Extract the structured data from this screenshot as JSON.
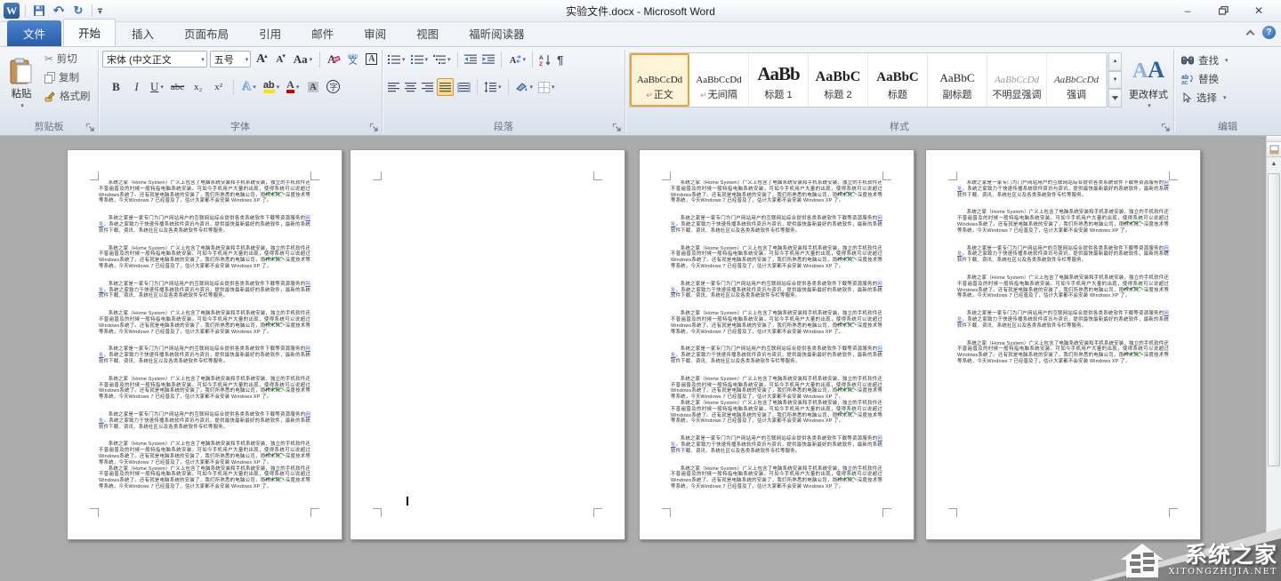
{
  "window": {
    "title": "实验文件.docx - Microsoft Word"
  },
  "icons": {
    "word_logo": "W",
    "save": "save-floppy",
    "undo": "↶",
    "redo": "↻",
    "dropdown": "▾",
    "qat_bar": "▬",
    "minimize": "–",
    "restore": "❐",
    "close": "✕",
    "help": "?",
    "collapse_ribbon": "chevron-up",
    "cut": "✂",
    "pilcrow": "¶",
    "return_mark": "↵",
    "scroll_up": "▲",
    "scroll_down": "▼",
    "grow_a": "A",
    "shrink_a": "A",
    "caret_up": "▴",
    "caret_down": "▾",
    "change_case": "Aa",
    "clear_format": "A",
    "phonetic_top": "wén",
    "phonetic_bottom": "文",
    "char_border": "A",
    "bold": "B",
    "italic": "I",
    "underline": "U",
    "strike": "abc",
    "subscript": "x₂",
    "superscript": "x²",
    "text_effect": "A",
    "highlight": "ab",
    "font_color": "A",
    "char_shade": "A",
    "enclose": "字",
    "sort": "A→Z↓",
    "aa_1": "A",
    "aa_2": "A"
  },
  "tabs": {
    "file": "文件",
    "items": [
      "开始",
      "插入",
      "页面布局",
      "引用",
      "邮件",
      "审阅",
      "视图",
      "福昕阅读器"
    ],
    "active_index": 0
  },
  "ribbon": {
    "clipboard": {
      "label": "剪贴板",
      "paste": "粘贴",
      "cut": "剪切",
      "copy": "复制",
      "format_painter": "格式刷"
    },
    "font": {
      "label": "字体",
      "name_value": "宋体 (中文正文",
      "size_value": "五号"
    },
    "paragraph": {
      "label": "段落"
    },
    "styles": {
      "label": "样式",
      "change": "更改样式",
      "items": [
        {
          "preview": "AaBbCcDd",
          "label": "正文",
          "kind": "body",
          "selected": true,
          "pilcrow": true
        },
        {
          "preview": "AaBbCcDd",
          "label": "无间隔",
          "kind": "body",
          "selected": false,
          "pilcrow": true
        },
        {
          "preview": "AaBb",
          "label": "标题 1",
          "kind": "h1",
          "selected": false,
          "pilcrow": false
        },
        {
          "preview": "AaBbC",
          "label": "标题 2",
          "kind": "h2",
          "selected": false,
          "pilcrow": false
        },
        {
          "preview": "AaBbC",
          "label": "标题",
          "kind": "title",
          "selected": false,
          "pilcrow": false
        },
        {
          "preview": "AaBbC",
          "label": "副标题",
          "kind": "subtitle",
          "selected": false,
          "pilcrow": false
        },
        {
          "preview": "AaBbCcDd",
          "label": "不明显强调",
          "kind": "subtle",
          "selected": false,
          "pilcrow": false
        },
        {
          "preview": "AaBbCcDd",
          "label": "强调",
          "kind": "emphasis",
          "selected": false,
          "pilcrow": false
        }
      ]
    },
    "editing": {
      "label": "编辑",
      "find": "查找",
      "replace": "替换",
      "select": "选择"
    }
  },
  "document": {
    "paragraph_types": {
      "A": {
        "segments": [
          {
            "text": "系统之家（Home System）广义上包含了电脑系统安装和手机系统安装，独立的手机软件还不普遍普及的时候一般特指电脑系统安装。可如今手机用户大量的出现，",
            "style": "plain"
          },
          {
            "text": "使得系统",
            "style": "spellcheck"
          },
          {
            "text": "可以说超过Windows系统了。还有就是电脑系统的安装了，我们所熟悉的电脑公司，雨林木风、深度技术等等系统，今天Windows 7 已经普及了，估计大家都不会安装 Windows XP 了。",
            "style": "plain"
          }
        ]
      },
      "B": {
        "segments": [
          {
            "text": "系统之家是一家专门为门户网站用户的互联网站综合提供各类系统软件下载等资源服务的",
            "style": "plain"
          },
          {
            "text": "网址",
            "style": "hyperlink"
          },
          {
            "text": "。系统之家致力于快速传播系统软件资讯与资讯，提供最快最新最好的系统软件，最新的系统软件下载、资讯、系统社区以及各类系统软件专栏等服务。",
            "style": "plain"
          }
        ]
      }
    },
    "pages": [
      {
        "sequence": [
          "A",
          "B",
          "A",
          "B",
          "A",
          "B",
          "A",
          "B",
          "A",
          "A-"
        ],
        "caret": false
      },
      {
        "sequence": [],
        "caret": true
      },
      {
        "sequence": [
          "A",
          "B",
          "A",
          "B",
          "A",
          "B",
          "A",
          "A-",
          "B",
          "A"
        ],
        "caret": false
      },
      {
        "sequence": [
          "B",
          "A",
          "B",
          "A",
          "B",
          "A"
        ],
        "caret": false
      }
    ]
  },
  "watermark": {
    "brand": "系统之家",
    "domain": "XITONGZHIJIA.NET"
  },
  "colors": {
    "accent_blue": "#2b579a",
    "selected_orange": "#e7a33e",
    "canvas_bg": "#ababab",
    "hyperlink": "#4a66c8",
    "spellcheck_green": "#3caa3c",
    "highlight_yellow": "#ffe400",
    "font_color_red": "#d40000"
  }
}
